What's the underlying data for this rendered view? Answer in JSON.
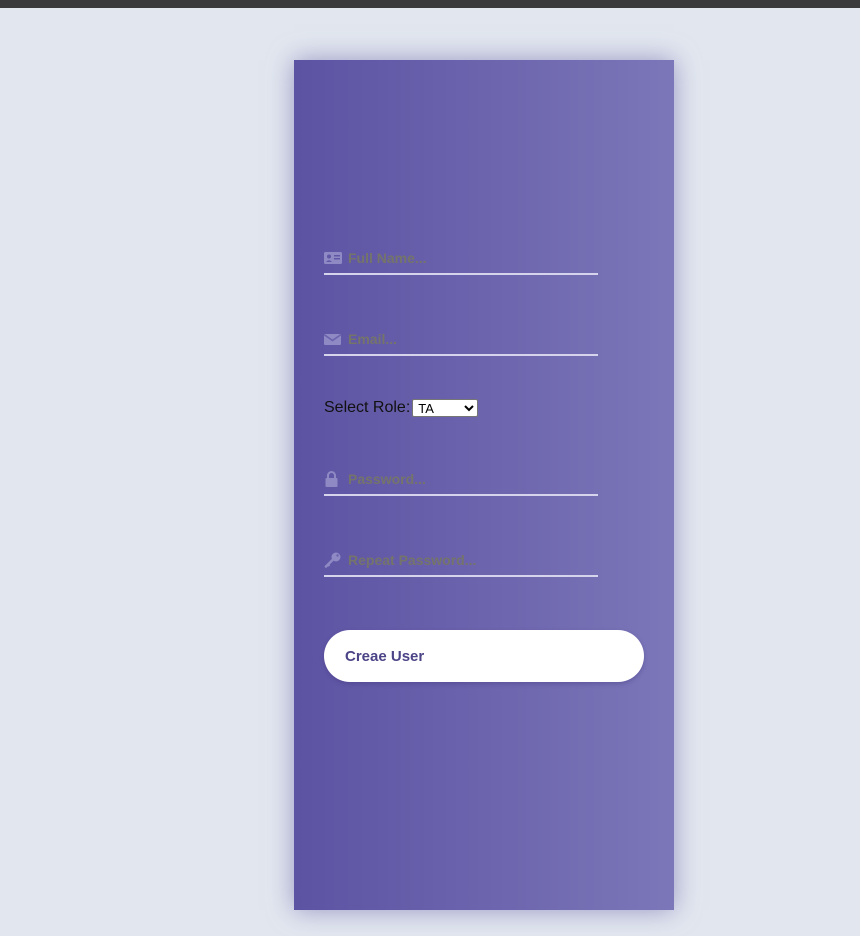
{
  "form": {
    "full_name": {
      "placeholder": "Full Name...",
      "value": "",
      "icon": "id-card-icon"
    },
    "email": {
      "placeholder": "Email...",
      "value": "",
      "icon": "envelope-icon"
    },
    "role": {
      "label": "Select Role:",
      "selected": "TA",
      "options": [
        "TA"
      ]
    },
    "password": {
      "placeholder": "Password...",
      "value": "",
      "icon": "lock-icon"
    },
    "repeat_password": {
      "placeholder": "Repeat Password...",
      "value": "",
      "icon": "key-icon"
    },
    "submit_label": "Creae User"
  },
  "colors": {
    "background": "#e2e7ef",
    "card_gradient_start": "#5c53a3",
    "card_gradient_end": "#7b77b9",
    "button_text": "#4b4487",
    "placeholder": "#75746a"
  }
}
